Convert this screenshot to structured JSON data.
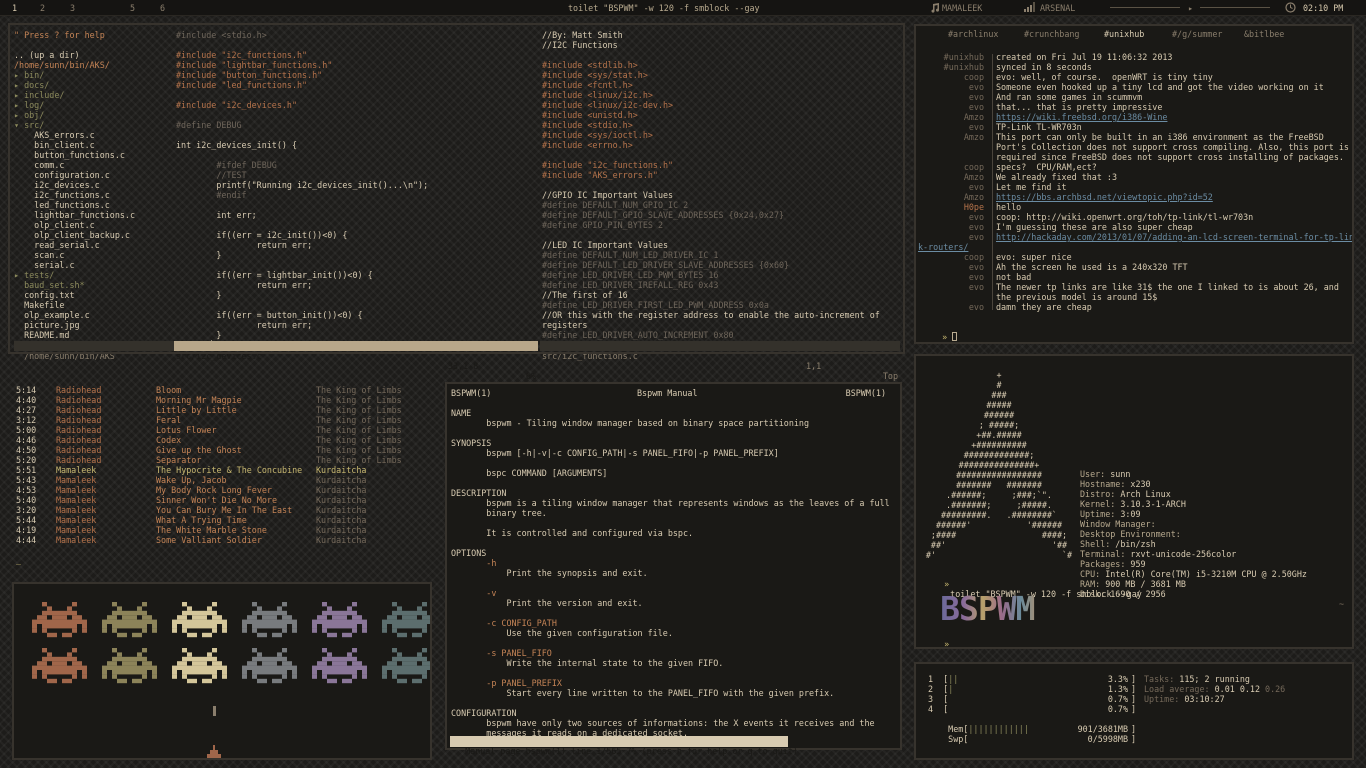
{
  "topbar": {
    "workspaces": [
      "1",
      "2",
      "3",
      "5",
      "6"
    ],
    "active_workspace": "1",
    "title": "toilet \"BSPWM\" -w 120 -f smblock --gay",
    "music": "Mamaleek",
    "network": "arsenal",
    "clock": "02:10 PM",
    "icons": [
      "music-note-icon",
      "wifi-icon",
      "volume-icon",
      "clock-icon"
    ]
  },
  "file_browser": {
    "help": "\" Press ? for help",
    "entries": [
      {
        "t": ".. (up a dir)",
        "c": "wht"
      },
      {
        "t": "/home/sunn/bin/AKS/",
        "c": "ora"
      },
      {
        "t": "▸ bin/",
        "c": "grn"
      },
      {
        "t": "▸ docs/",
        "c": "grn"
      },
      {
        "t": "▸ include/",
        "c": "grn"
      },
      {
        "t": "▸ log/",
        "c": "grn"
      },
      {
        "t": "▸ obj/",
        "c": "grn"
      },
      {
        "t": "▾ src/",
        "c": "grn"
      },
      {
        "t": "    AKS_errors.c",
        "c": "wht"
      },
      {
        "t": "    bin_client.c",
        "c": "wht"
      },
      {
        "t": "    button_functions.c",
        "c": "wht"
      },
      {
        "t": "    comm.c",
        "c": "wht"
      },
      {
        "t": "    configuration.c",
        "c": "wht"
      },
      {
        "t": "    i2c_devices.c",
        "c": "wht"
      },
      {
        "t": "    i2c_functions.c",
        "c": "wht"
      },
      {
        "t": "    led_functions.c",
        "c": "wht"
      },
      {
        "t": "    lightbar_functions.c",
        "c": "wht"
      },
      {
        "t": "    olp_client.c",
        "c": "wht"
      },
      {
        "t": "    olp_client_backup.c",
        "c": "wht"
      },
      {
        "t": "    read_serial.c",
        "c": "wht"
      },
      {
        "t": "    scan.c",
        "c": "wht"
      },
      {
        "t": "    serial.c",
        "c": "wht"
      },
      {
        "t": "▸ tests/",
        "c": "grn"
      },
      {
        "t": "  baud_set.sh*",
        "c": "grn"
      },
      {
        "t": "  config.txt",
        "c": "wht"
      },
      {
        "t": "  Makefile",
        "c": "wht"
      },
      {
        "t": "  olp_example.c",
        "c": "wht"
      },
      {
        "t": "  picture.jpg",
        "c": "wht"
      },
      {
        "t": "  README.md",
        "c": "wht"
      }
    ],
    "status": "/home/sunn/bin/AKS"
  },
  "editor_left": {
    "lines": [
      {
        "t": "#include <stdio.h>",
        "c": "cmt"
      },
      {
        "t": "",
        "c": "wht"
      },
      {
        "t": "#include \"i2c_functions.h\"",
        "c": "red"
      },
      {
        "t": "#include \"lightbar_functions.h\"",
        "c": "red"
      },
      {
        "t": "#include \"button_functions.h\"",
        "c": "red"
      },
      {
        "t": "#include \"led_functions.h\"",
        "c": "red"
      },
      {
        "t": "",
        "c": "wht"
      },
      {
        "t": "#include \"i2c_devices.h\"",
        "c": "red"
      },
      {
        "t": "",
        "c": "wht"
      },
      {
        "t": "#define DEBUG",
        "c": "cmt"
      },
      {
        "t": "",
        "c": "wht"
      },
      {
        "t": "int i2c_devices_init() {",
        "c": "wht"
      },
      {
        "t": "",
        "c": "wht"
      },
      {
        "t": "        #ifdef DEBUG",
        "c": "cmt"
      },
      {
        "t": "        //TEST",
        "c": "cmt"
      },
      {
        "t": "        printf(\"Running i2c_devices_init()...\\n\");",
        "c": "wht"
      },
      {
        "t": "        #endif",
        "c": "cmt"
      },
      {
        "t": "",
        "c": "wht"
      },
      {
        "t": "        int err;",
        "c": "wht"
      },
      {
        "t": "",
        "c": "wht"
      },
      {
        "t": "        if((err = i2c_init())<0) {",
        "c": "wht"
      },
      {
        "t": "                return err;",
        "c": "wht"
      },
      {
        "t": "        }",
        "c": "wht"
      },
      {
        "t": "",
        "c": "wht"
      },
      {
        "t": "        if((err = lightbar_init())<0) {",
        "c": "wht"
      },
      {
        "t": "                return err;",
        "c": "wht"
      },
      {
        "t": "        }",
        "c": "wht"
      },
      {
        "t": "",
        "c": "wht"
      },
      {
        "t": "        if((err = button_init())<0) {",
        "c": "wht"
      },
      {
        "t": "                return err;",
        "c": "wht"
      },
      {
        "t": "        }",
        "c": "wht"
      },
      {
        "t": "       ▏ if((err = led_init())<0) {",
        "c": "wht"
      }
    ],
    "status_file": "src/i2c_devices.c",
    "status_pos": "33,1-8",
    "status_pct": "6%"
  },
  "editor_right": {
    "lines": [
      {
        "t": "//By: Matt Smith",
        "c": "wht"
      },
      {
        "t": "//I2C Functions",
        "c": "wht"
      },
      {
        "t": "",
        "c": "wht"
      },
      {
        "t": "#include <stdlib.h>",
        "c": "red"
      },
      {
        "t": "#include <sys/stat.h>",
        "c": "red"
      },
      {
        "t": "#include <fcntl.h>",
        "c": "red"
      },
      {
        "t": "#include <linux/i2c.h>",
        "c": "red"
      },
      {
        "t": "#include <linux/i2c-dev.h>",
        "c": "red"
      },
      {
        "t": "#include <unistd.h>",
        "c": "red"
      },
      {
        "t": "#include <stdio.h>",
        "c": "red"
      },
      {
        "t": "#include <sys/ioctl.h>",
        "c": "red"
      },
      {
        "t": "#include <errno.h>",
        "c": "red"
      },
      {
        "t": "",
        "c": "wht"
      },
      {
        "t": "#include \"i2c_functions.h\"",
        "c": "red"
      },
      {
        "t": "#include \"AKS_errors.h\"",
        "c": "red"
      },
      {
        "t": "",
        "c": "wht"
      },
      {
        "t": "//GPIO IC Important Values",
        "c": "wht"
      },
      {
        "t": "#define DEFAULT_NUM_GPIO_IC 2",
        "c": "cmt"
      },
      {
        "t": "#define DEFAULT_GPIO_SLAVE_ADDRESSES {0x24,0x27}",
        "c": "cmt"
      },
      {
        "t": "#define GPIO_PIN_BYTES 2",
        "c": "cmt"
      },
      {
        "t": "",
        "c": "wht"
      },
      {
        "t": "//LED IC Important Values",
        "c": "wht"
      },
      {
        "t": "#define DEFAULT_NUM_LED_DRIVER_IC 1",
        "c": "cmt"
      },
      {
        "t": "#define DEFAULT_LED_DRIVER_SLAVE_ADDRESSES {0x60}",
        "c": "cmt"
      },
      {
        "t": "#define LED_DRIVER_LED_PWM_BYTES 16",
        "c": "cmt"
      },
      {
        "t": "#define LED_DRIVER_IREFALL_REG 0x43",
        "c": "cmt"
      },
      {
        "t": "//The first of 16",
        "c": "wht"
      },
      {
        "t": "#define LED_DRIVER_FIRST_LED_PWM_ADDRESS 0x0a",
        "c": "cmt"
      },
      {
        "t": "//OR this with the register address to enable the auto-increment of",
        "c": "wht"
      },
      {
        "t": "registers",
        "c": "wht"
      },
      {
        "t": "#define LED_DRIVER_AUTO_INCREMENT 0x80",
        "c": "cmt"
      }
    ],
    "status_file": "src/i2c_functions.c",
    "status_pos": "1,1",
    "status_pct": "Top"
  },
  "irc": {
    "tabs": [
      "#archlinux",
      "#crunchbang",
      "#unixhub",
      "#/g/summer",
      "&bitlbee"
    ],
    "active_tab": "#unixhub",
    "lines": [
      {
        "n": "#unixhub",
        "m": "created on Fri Jul 19 11:06:32 2013",
        "nc": "dim",
        "mc": "wht"
      },
      {
        "n": "#unixhub",
        "m": "synced in 8 seconds",
        "nc": "dim",
        "mc": "wht"
      },
      {
        "n": "coop",
        "m": "evo: well, of course.  openWRT is tiny tiny",
        "nc": "dim",
        "mc": "wht"
      },
      {
        "n": "evo",
        "m": "Someone even hooked up a tiny lcd and got the video working on it",
        "nc": "dim",
        "mc": "wht"
      },
      {
        "n": "evo",
        "m": "And ran some games in scummvm",
        "nc": "dim",
        "mc": "wht"
      },
      {
        "n": "evo",
        "m": "that... that is pretty impressive",
        "nc": "dim",
        "mc": "wht"
      },
      {
        "n": "Amzo",
        "m": "https://wiki.freebsd.org/i386-Wine",
        "nc": "dim",
        "mc": "lnk"
      },
      {
        "n": "evo",
        "m": "TP-Link TL-WR703n",
        "nc": "dim",
        "mc": "wht"
      },
      {
        "n": "Amzo",
        "m": "This port can only be built in an i386 environment as the FreeBSD",
        "nc": "dim",
        "mc": "wht"
      },
      {
        "n": "",
        "m": "Port's Collection does not support cross compiling. Also, this port is",
        "nc": "dim",
        "mc": "wht"
      },
      {
        "n": "",
        "m": "required since FreeBSD does not support cross installing of packages.",
        "nc": "dim",
        "mc": "wht"
      },
      {
        "n": "coop",
        "m": "specs?  CPU/RAM,ect?",
        "nc": "dim",
        "mc": "wht"
      },
      {
        "n": "Amzo",
        "m": "We already fixed that :3",
        "nc": "dim",
        "mc": "wht"
      },
      {
        "n": "evo",
        "m": "Let me find it",
        "nc": "dim",
        "mc": "wht"
      },
      {
        "n": "Amzo",
        "m": "https://bbs.archbsd.net/viewtopic.php?id=52",
        "nc": "dim",
        "mc": "lnk"
      },
      {
        "n": "H0pe",
        "m": "hello",
        "nc": "red",
        "mc": "wht"
      },
      {
        "n": "evo",
        "m": "coop: http://wiki.openwrt.org/toh/tp-link/tl-wr703n",
        "nc": "dim",
        "mc": "wht"
      },
      {
        "n": "evo",
        "m": "I'm guessing these are also super cheap",
        "nc": "dim",
        "mc": "wht"
      },
      {
        "n": "evo",
        "m": "http://hackaday.com/2013/01/07/adding-an-lcd-screen-terminal-for-tp-lin",
        "nc": "dim",
        "mc": "lnk"
      },
      {
        "n": "k-routers/",
        "m": "",
        "nc": "lnk",
        "mc": "wht"
      },
      {
        "n": "coop",
        "m": "evo: super nice",
        "nc": "dim",
        "mc": "wht"
      },
      {
        "n": "evo",
        "m": "Ah the screen he used is a 240x320 TFT",
        "nc": "dim",
        "mc": "wht"
      },
      {
        "n": "evo",
        "m": "not bad",
        "nc": "dim",
        "mc": "wht"
      },
      {
        "n": "evo",
        "m": "The newer tp links are like 31$ the one I linked to is about 26, and",
        "nc": "dim",
        "mc": "wht"
      },
      {
        "n": "",
        "m": "the previous model is around 15$",
        "nc": "dim",
        "mc": "wht"
      },
      {
        "n": "evo",
        "m": "damn they are cheap",
        "nc": "dim",
        "mc": "wht"
      }
    ],
    "prompt": "» "
  },
  "music": {
    "tracks": [
      {
        "len": "5:14",
        "artist": "Radiohead",
        "title": "Bloom",
        "album": "The King of Limbs"
      },
      {
        "len": "4:40",
        "artist": "Radiohead",
        "title": "Morning Mr Magpie",
        "album": "The King of Limbs"
      },
      {
        "len": "4:27",
        "artist": "Radiohead",
        "title": "Little by Little",
        "album": "The King of Limbs"
      },
      {
        "len": "3:12",
        "artist": "Radiohead",
        "title": "Feral",
        "album": "The King of Limbs"
      },
      {
        "len": "5:00",
        "artist": "Radiohead",
        "title": "Lotus Flower",
        "album": "The King of Limbs"
      },
      {
        "len": "4:46",
        "artist": "Radiohead",
        "title": "Codex",
        "album": "The King of Limbs"
      },
      {
        "len": "4:50",
        "artist": "Radiohead",
        "title": "Give up the Ghost",
        "album": "The King of Limbs"
      },
      {
        "len": "5:20",
        "artist": "Radiohead",
        "title": "Separator",
        "album": "The King of Limbs"
      },
      {
        "len": "5:51",
        "artist": "Mamaleek",
        "title": "The Hypocrite & The Concubine",
        "album": "Kurdaitcha"
      },
      {
        "len": "5:43",
        "artist": "Mamaleek",
        "title": "Wake Up, Jacob",
        "album": "Kurdaitcha"
      },
      {
        "len": "4:53",
        "artist": "Mamaleek",
        "title": "My Body Rock Long Fever",
        "album": "Kurdaitcha"
      },
      {
        "len": "5:40",
        "artist": "Mamaleek",
        "title": "Sinner Won't Die No More",
        "album": "Kurdaitcha"
      },
      {
        "len": "3:20",
        "artist": "Mamaleek",
        "title": "You Can Bury Me In The East",
        "album": "Kurdaitcha"
      },
      {
        "len": "5:44",
        "artist": "Mamaleek",
        "title": "What A Trying Time",
        "album": "Kurdaitcha"
      },
      {
        "len": "4:19",
        "artist": "Mamaleek",
        "title": "The White Marble Stone",
        "album": "Kurdaitcha"
      },
      {
        "len": "4:44",
        "artist": "Mamaleek",
        "title": "Some Valliant Soldier",
        "album": "Kurdaitcha"
      }
    ],
    "playing_index": 8,
    "prompt": "_"
  },
  "invaders": {
    "colors": [
      "#a0664a",
      "#8c8359",
      "#d4c69a",
      "#787b7e",
      "#8a7698",
      "#5c6e6e"
    ],
    "icons": [
      "space-invader-icon",
      "player-ship-icon"
    ]
  },
  "manpage": {
    "header_left": "BSPWM(1)",
    "header_center": "Bspwm Manual",
    "header_right": "BSPWM(1)",
    "lines": [
      {
        "t": "",
        "c": "wht"
      },
      {
        "t": "NAME",
        "c": "wht"
      },
      {
        "t": "       bspwm - Tiling window manager based on binary space partitioning",
        "c": "wht"
      },
      {
        "t": "",
        "c": "wht"
      },
      {
        "t": "SYNOPSIS",
        "c": "wht"
      },
      {
        "t": "       bspwm [-h|-v|-c CONFIG_PATH|-s PANEL_FIFO|-p PANEL_PREFIX]",
        "c": "wht"
      },
      {
        "t": "",
        "c": "wht"
      },
      {
        "t": "       bspc COMMAND [ARGUMENTS]",
        "c": "wht"
      },
      {
        "t": "",
        "c": "wht"
      },
      {
        "t": "DESCRIPTION",
        "c": "wht"
      },
      {
        "t": "       bspwm is a tiling window manager that represents windows as the leaves of a full",
        "c": "wht"
      },
      {
        "t": "       binary tree.",
        "c": "wht"
      },
      {
        "t": "",
        "c": "wht"
      },
      {
        "t": "       It is controlled and configured via bspc.",
        "c": "wht"
      },
      {
        "t": "",
        "c": "wht"
      },
      {
        "t": "OPTIONS",
        "c": "wht"
      },
      {
        "t": "       -h",
        "c": "ora"
      },
      {
        "t": "           Print the synopsis and exit.",
        "c": "wht"
      },
      {
        "t": "",
        "c": "wht"
      },
      {
        "t": "       -v",
        "c": "ora"
      },
      {
        "t": "           Print the version and exit.",
        "c": "wht"
      },
      {
        "t": "",
        "c": "wht"
      },
      {
        "t": "       -c CONFIG_PATH",
        "c": "ora"
      },
      {
        "t": "           Use the given configuration file.",
        "c": "wht"
      },
      {
        "t": "",
        "c": "wht"
      },
      {
        "t": "       -s PANEL_FIFO",
        "c": "ora"
      },
      {
        "t": "           Write the internal state to the given FIFO.",
        "c": "wht"
      },
      {
        "t": "",
        "c": "wht"
      },
      {
        "t": "       -p PANEL_PREFIX",
        "c": "ora"
      },
      {
        "t": "           Start every line written to the PANEL_FIFO with the given prefix.",
        "c": "wht"
      },
      {
        "t": "",
        "c": "wht"
      },
      {
        "t": "CONFIGURATION",
        "c": "wht"
      },
      {
        "t": "       bspwm have only two sources of informations: the X events it receives and the",
        "c": "wht"
      },
      {
        "t": "       messages it reads on a dedicated socket.",
        "c": "wht"
      }
    ],
    "status": " Manual page bspwm(1) line 1/565 7% (press h for help or q to quit)"
  },
  "fetch": {
    "logo": [
      "+",
      "#",
      "###",
      "#####",
      "######",
      "; #####;",
      "+##.#####",
      "+##########",
      "#############;",
      "###############+",
      "#################",
      "#######   #######",
      ".######;     ;###;`\".",
      ".#######;     ;#####.",
      "#########.   .########`",
      "######'           '######",
      ";####                 ####;",
      "##'                     '##",
      "#'                         `#"
    ],
    "info": [
      {
        "k": "User:",
        "v": " sunn"
      },
      {
        "k": "Hostname:",
        "v": " x230"
      },
      {
        "k": "Distro:",
        "v": " Arch Linux"
      },
      {
        "k": "Kernel:",
        "v": " 3.10.3-1-ARCH"
      },
      {
        "k": "Uptime:",
        "v": " 3:09"
      },
      {
        "k": "Window Manager:",
        "v": ""
      },
      {
        "k": "Desktop Environment:",
        "v": ""
      },
      {
        "k": "Shell:",
        "v": " /bin/zsh"
      },
      {
        "k": "Terminal:",
        "v": " rxvt-unicode-256color"
      },
      {
        "k": "Packages:",
        "v": " 959"
      },
      {
        "k": "CPU:",
        "v": " Intel(R) Core(TM) i5-3210M CPU @ 2.50GHz"
      },
      {
        "k": "RAM:",
        "v": " 900 MB / 3681 MB"
      },
      {
        "k": "Disk:",
        "v": " 1690 / 2956"
      }
    ],
    "cmd1_prompt": "»",
    "cmd1": "toilet \"BSPWM\" -w 120 -f smblock --gay",
    "banner": "BSPWM",
    "cmd2_prompt": "»",
    "cmd2": "scrot",
    "tilde": "~"
  },
  "htop": {
    "cpus": [
      {
        "label": "1",
        "bar": "||",
        "pct": "3.3%",
        "fill": 0.033
      },
      {
        "label": "2",
        "bar": "|",
        "pct": "1.3%",
        "fill": 0.013
      },
      {
        "label": "3",
        "bar": "",
        "pct": "0.7%",
        "fill": 0.007
      },
      {
        "label": "4",
        "bar": "",
        "pct": "0.7%",
        "fill": 0.007
      }
    ],
    "mem_label": "Mem",
    "mem_bar": "||||||||||||",
    "mem_val": "901/3681MB",
    "swp_label": "Swp",
    "swp_bar": "",
    "swp_val": "0/5998MB",
    "tasks_label": "Tasks:",
    "tasks": " 115;",
    "running": " 2 running",
    "load_label": "Load average:",
    "load1": " 0.01",
    "load5": " 0.12",
    "load15": " 0.26",
    "uptime_label": "Uptime:",
    "uptime": " 03:10:27"
  }
}
